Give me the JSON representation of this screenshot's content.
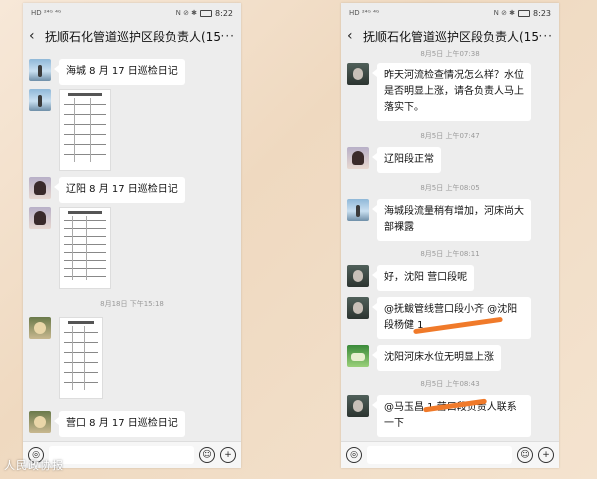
{
  "left": {
    "status": {
      "signal": "HD ²⁴ᴳ ⁴ᴳ",
      "right_icons": "N ⊘ ✱",
      "time": "8:22"
    },
    "header": {
      "title": "抚顺石化管道巡护区段负责人(15)",
      "back": "‹",
      "more": "···"
    },
    "messages": [
      {
        "text": "海城 8 月 17 日巡检日记"
      },
      {
        "text": "辽阳 8 月 17 日巡检日记"
      },
      {
        "text": "营口 8 月 17 日巡检日记"
      }
    ],
    "time1": "8月18日 下午15:18"
  },
  "right": {
    "status": {
      "signal": "HD ²⁴ᴳ ⁴ᴳ",
      "right_icons": "N ⊘ ✱",
      "time": "8:23"
    },
    "header": {
      "title": "抚顺石化管道巡护区段负责人(15)",
      "back": "‹",
      "more": "···"
    },
    "times": [
      "8月5日 上午07:38",
      "8月5日 上午07:47",
      "8月5日 上午08:05",
      "8月5日 上午08:11",
      "8月5日 上午08:43"
    ],
    "messages": [
      {
        "text": "昨天河流检查情况怎么样？水位是否明显上涨，请各负责人马上落实下。"
      },
      {
        "text": "辽阳段正常"
      },
      {
        "text": "海城段流量稍有增加，河床尚大部裸露"
      },
      {
        "text": "好，沈阳 营口段呢"
      },
      {
        "text": "@抚鲅管线营口段小齐 @沈阳段杨健 1"
      },
      {
        "text": "沈阳河床水位无明显上涨"
      },
      {
        "text": "@马玉昌 1 营口段负责人联系一下"
      }
    ]
  },
  "input_icons": {
    "voice": "◎",
    "emoji": "☺",
    "add": "+"
  },
  "watermark": "人民政协报",
  "colors": {
    "chat_bg": "#ededed",
    "bubble": "#ffffff",
    "redaction": "#f07a2a"
  }
}
